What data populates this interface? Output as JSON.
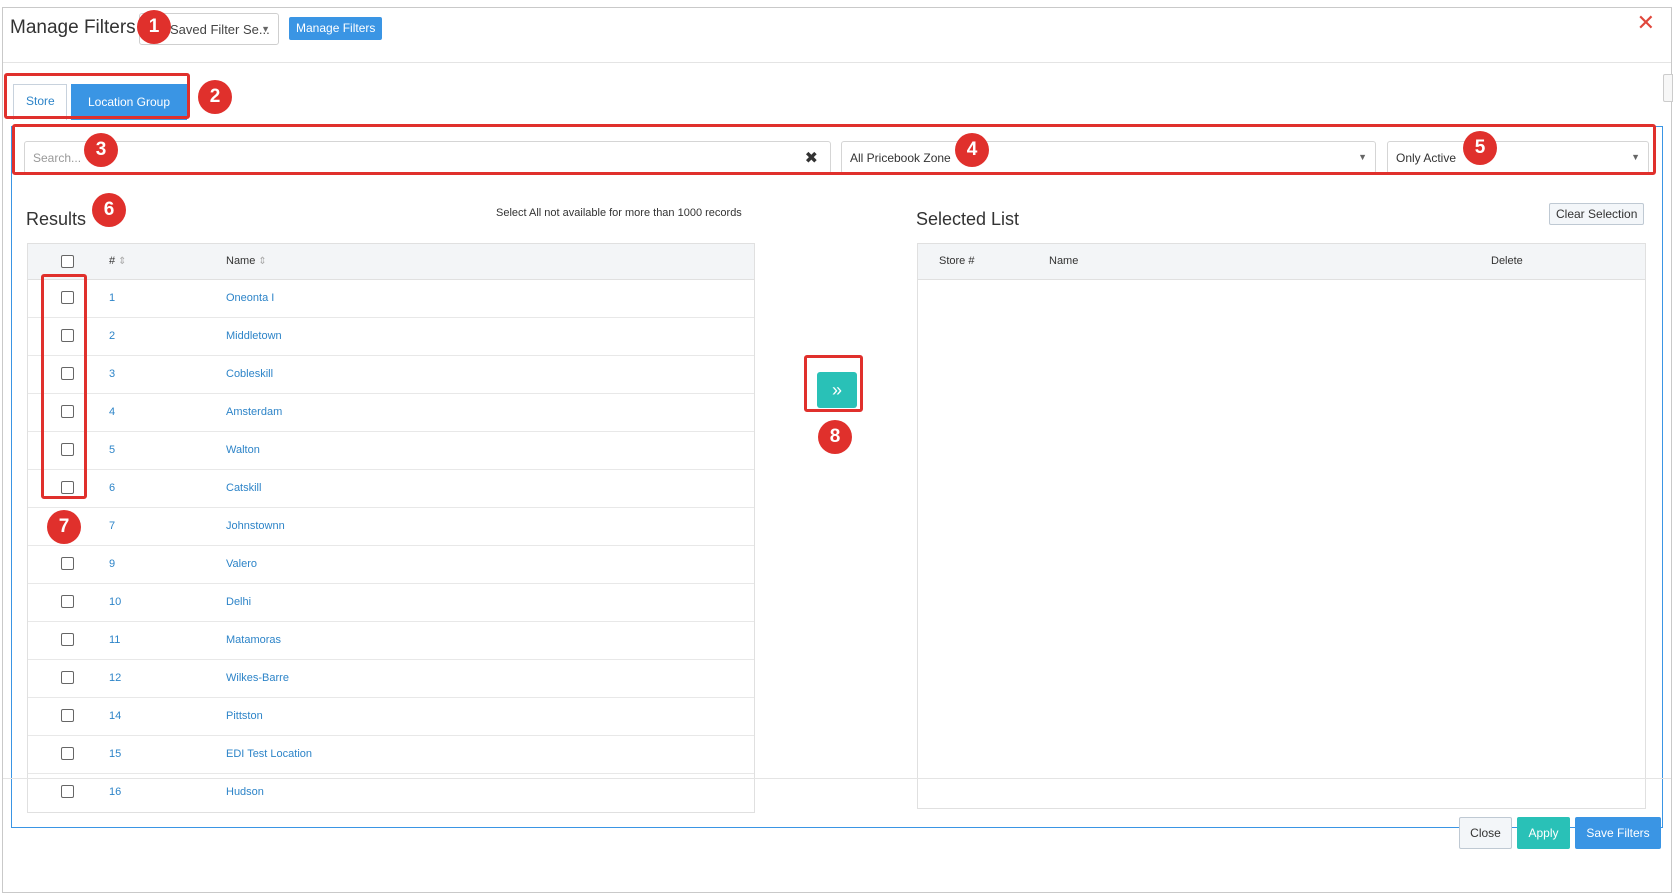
{
  "header": {
    "title": "Manage Filters",
    "saved_filter_placeholder": "Saved Filter Se...",
    "manage_button": "Manage Filters",
    "close_symbol": "✕"
  },
  "tabs": [
    {
      "label": "Store",
      "active": false
    },
    {
      "label": "Location Group",
      "active": true
    }
  ],
  "filters": {
    "search_placeholder": "Search...",
    "clear_symbol": "✖",
    "zone_selected": "All Pricebook Zone",
    "status_selected": "Only Active"
  },
  "results": {
    "title": "Results",
    "note": "Select All not available for more than 1000 records",
    "columns": {
      "num": "#",
      "name": "Name"
    },
    "rows": [
      {
        "num": "1",
        "name": "Oneonta I"
      },
      {
        "num": "2",
        "name": "Middletown"
      },
      {
        "num": "3",
        "name": "Cobleskill"
      },
      {
        "num": "4",
        "name": "Amsterdam"
      },
      {
        "num": "5",
        "name": "Walton"
      },
      {
        "num": "6",
        "name": "Catskill"
      },
      {
        "num": "7",
        "name": "Johnstownn"
      },
      {
        "num": "9",
        "name": "Valero"
      },
      {
        "num": "10",
        "name": "Delhi"
      },
      {
        "num": "11",
        "name": "Matamoras"
      },
      {
        "num": "12",
        "name": "Wilkes-Barre"
      },
      {
        "num": "14",
        "name": "Pittston"
      },
      {
        "num": "15",
        "name": "EDI Test Location"
      },
      {
        "num": "16",
        "name": "Hudson"
      }
    ]
  },
  "move_button": "»",
  "selected": {
    "title": "Selected List",
    "clear_button": "Clear Selection",
    "columns": {
      "store": "Store #",
      "name": "Name",
      "delete": "Delete"
    }
  },
  "footer": {
    "close": "Close",
    "apply": "Apply",
    "save": "Save Filters"
  },
  "annotations": [
    "1",
    "2",
    "3",
    "4",
    "5",
    "6",
    "7",
    "8"
  ],
  "colors": {
    "primary": "#3a95e4",
    "teal": "#29c1b7",
    "link": "#2d84c8",
    "annotation": "#e0302c"
  }
}
